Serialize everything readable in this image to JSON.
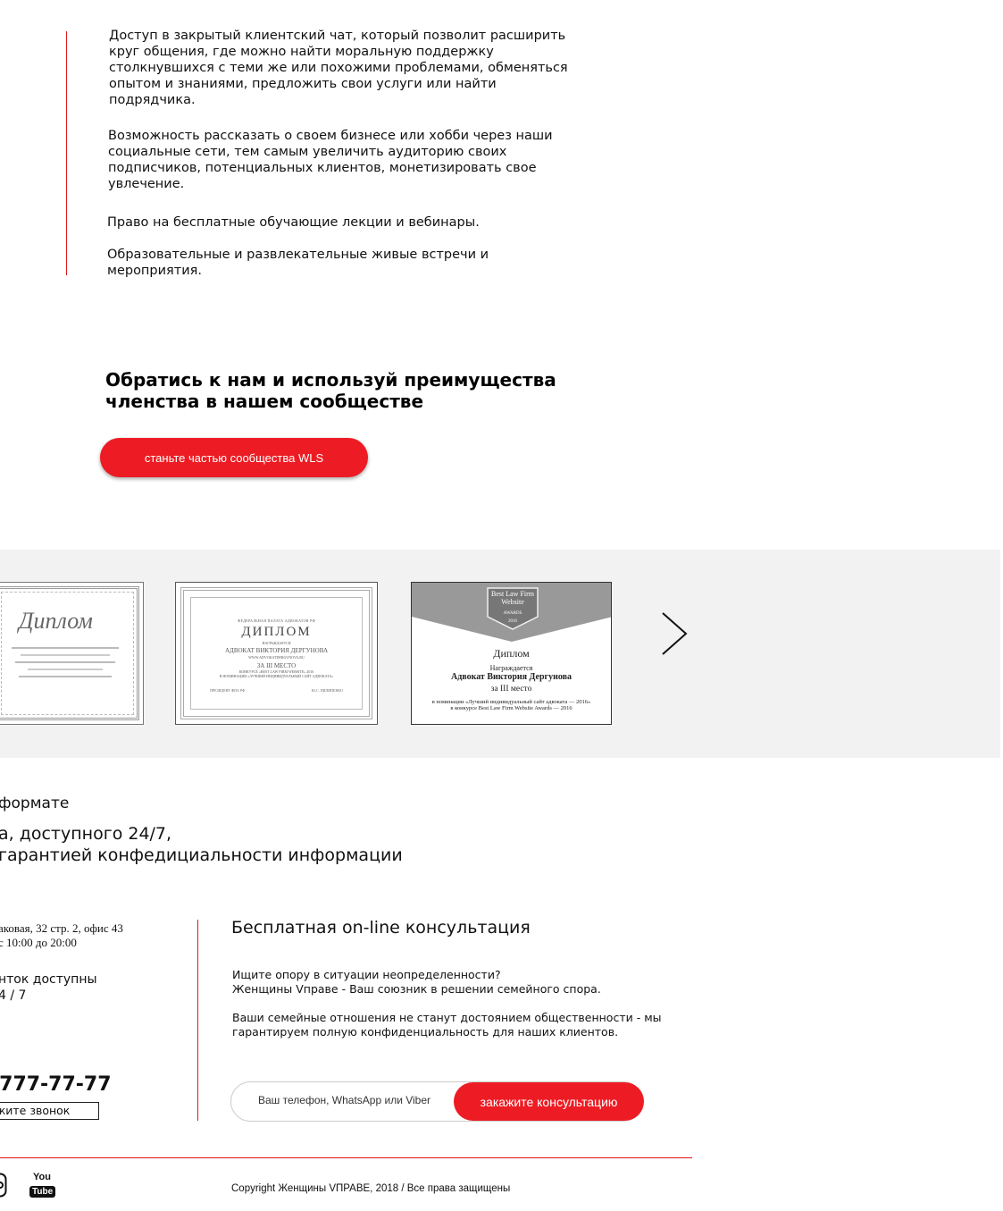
{
  "benefits": [
    "Доступ в закрытый клиентский чат, который позволит расширить круг общения,  где можно найти моральную поддержку столкнувшихся с теми же или похожими проблемами, обменяться опытом и знаниями, предложить свои услуги или найти подрядчика.",
    "Возможность рассказать о своем бизнесе или хобби через наши социальные сети, тем самым увеличить аудиторию своих подписчиков, потенциальных клиентов, монетизировать свое увлечение.",
    "Право на бесплатные обучающие лекции и вебинары.",
    "Образовательные и развлекательные живые встречи и мероприятия."
  ],
  "cta": {
    "heading_line1": "Обратись к нам и используй преимущества",
    "heading_line2": "членства в нашем сообществе",
    "button": "станьте частью сообщества WLS"
  },
  "gallery": {
    "card1": {
      "title": "Диплом"
    },
    "card2": {
      "org": "ФЕДЕРАЛЬНАЯ ПАЛАТА АДВОКАТОВ РФ",
      "title": "ДИПЛОМ",
      "awarded": "НАГРАЖДАЕТСЯ",
      "name": "АДВОКАТ ВИКТОРИЯ ДЕРГУНОВА",
      "site": "WWW.ADVOKATDERGUNOVA.RU",
      "place": "ЗА III МЕСТО",
      "contest": "КОНКУРСЕ «BEST LAW FIRM WEBSITE» 2016",
      "nomination": "В НОМИНАЦИИ «ЛУЧШИЙ ИНДИВИДУАЛЬНЫЙ САЙТ АДВОКАТА»",
      "signature_left": "ПРЕЗИДЕНТ ФПА РФ",
      "signature_right": "Ю.С. ПИЛИПЕНКО"
    },
    "card3": {
      "badge_line1": "Best Law Firm",
      "badge_line2": "Website",
      "badge_line3": "AWARDS",
      "badge_line4": "2016",
      "title": "Диплом",
      "awarded": "Награждается",
      "name": "Адвокат Виктория Дергунова",
      "place": "за III место",
      "nomination": "в номинации «Лучший индивидуальный сайт адвоката — 2016»",
      "contest": "в конкурсе Best Law Firm Website Awards — 2016"
    }
  },
  "info": {
    "line1": "формате",
    "line2": "а, доступного 24/7,",
    "line3": "гарантией конфедициальности информации"
  },
  "contacts": {
    "address": "аковая, 32 стр. 2, офис 43",
    "hours": "с 10:00 до 20:00",
    "calls_line1": "нток доступны",
    "calls_line2": "4 / 7",
    "phone": "-777-77-77",
    "callback": "жите звонок"
  },
  "consultation": {
    "title": "Бесплатная on-line консультация",
    "p1_line1": "Ищите опору в ситуации неопределенности?",
    "p1_line2": "Женщины Vправе - Ваш союзник в решении семейного спора.",
    "p2_line1": "Ваши семейные отношения не станут достоянием общественности - мы",
    "p2_line2": "гарантируем полную конфиденциальность для наших клиентов.",
    "input_placeholder": "Ваш телефон, WhatsApp или Viber",
    "button": "закажите  консультацию"
  },
  "footer": {
    "youtube_top": "You",
    "youtube_bottom": "Tube",
    "copyright": "Copyright Женщины VПРАВЕ, 2018  / Все права защищены"
  },
  "colors": {
    "accent": "#ed1c24",
    "gallery_bg": "#f2f2f2",
    "divider": "#e0161b"
  }
}
